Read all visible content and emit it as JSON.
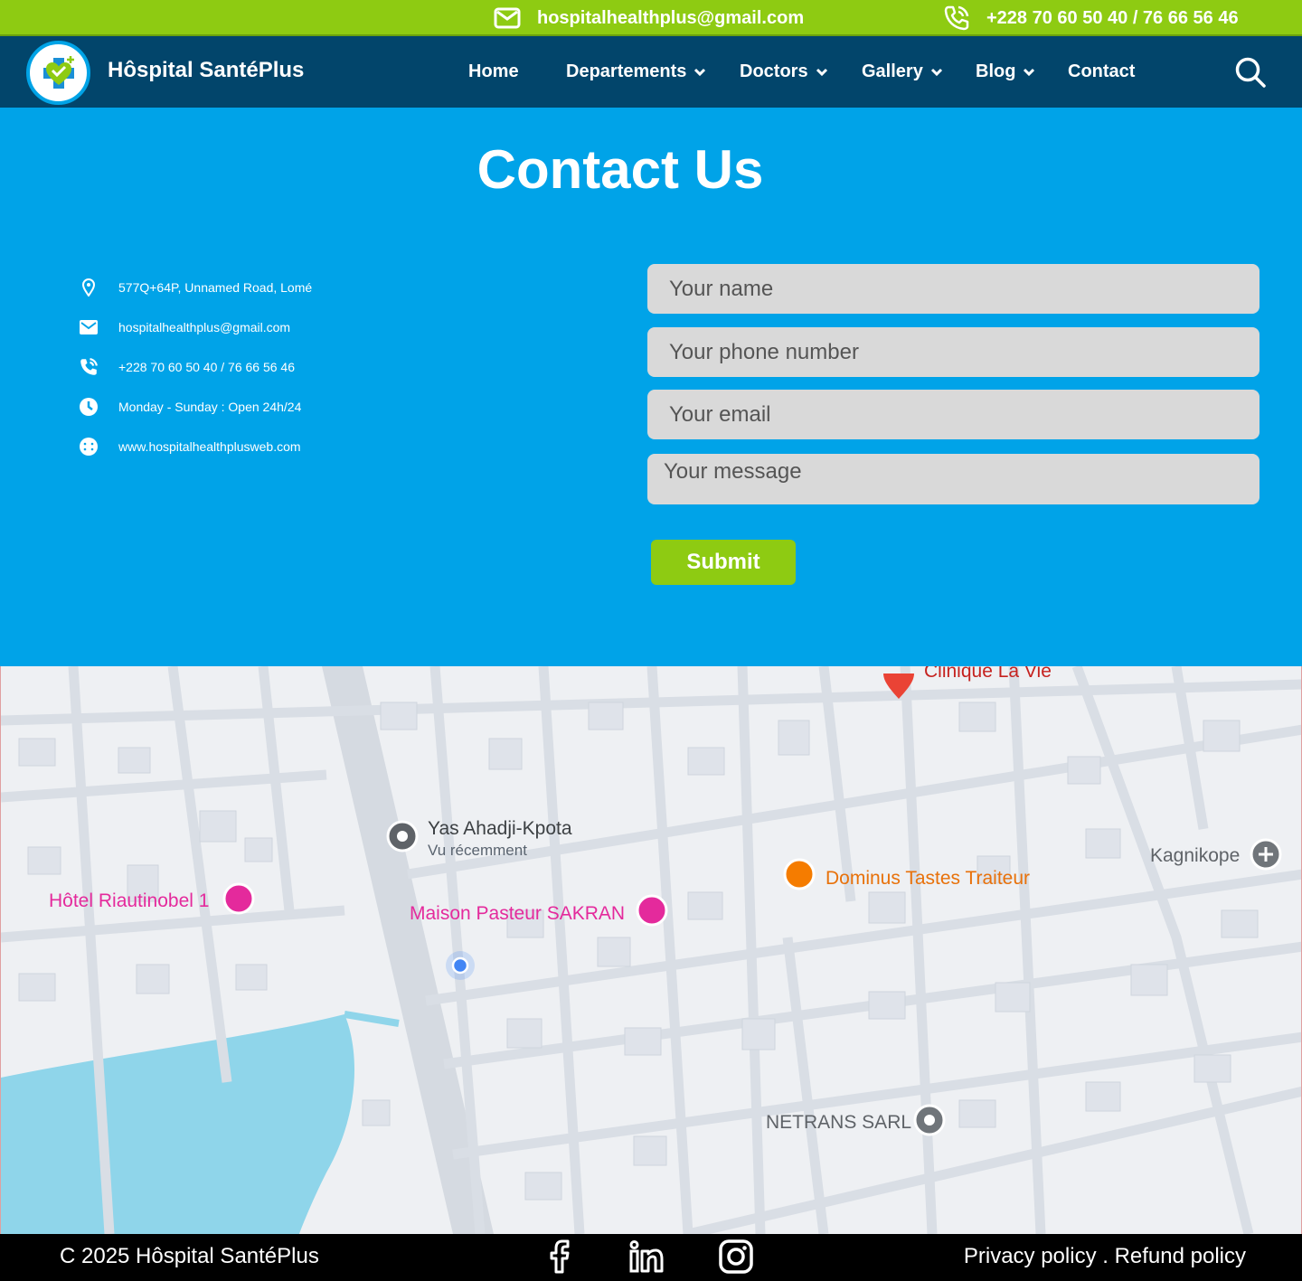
{
  "topbar": {
    "email": "hospitalhealthplus@gmail.com",
    "phone": "+228 70 60 50 40 / 76 66 56 46",
    "icons": {
      "email": "envelope-icon",
      "phone": "phone-icon"
    }
  },
  "nav": {
    "brand": "Hôspital SantéPlus",
    "items": [
      {
        "label": "Home"
      },
      {
        "label": "Departements"
      },
      {
        "label": "Doctors"
      },
      {
        "label": "Gallery"
      },
      {
        "label": "Blog"
      },
      {
        "label": "Contact"
      }
    ]
  },
  "contact": {
    "title": "Contact Us",
    "info": [
      {
        "icon": "location-pin-icon",
        "text": "577Q+64P, Unnamed Road, Lomé"
      },
      {
        "icon": "envelope-icon",
        "text": "hospitalhealthplus@gmail.com"
      },
      {
        "icon": "phone-icon",
        "text": "+228 70 60 50 40 / 76 66 56 46"
      },
      {
        "icon": "clock-icon",
        "text": "Monday - Sunday : Open 24h/24"
      },
      {
        "icon": "globe-icon",
        "text": "www.hospitalhealthplusweb.com"
      }
    ],
    "form": {
      "name_placeholder": "Your name",
      "phone_placeholder": "Your phone number",
      "email_placeholder": "Your email",
      "message_placeholder": "Your message",
      "submit_label": "Submit"
    }
  },
  "map": {
    "places": [
      {
        "name": "Clinique La Vie",
        "color": "#c5221f"
      },
      {
        "name": "Yas Ahadji-Kpota",
        "sub": "Vu récemment",
        "color": "#3c4043"
      },
      {
        "name": "Dominus Tastes Traiteur",
        "color": "#e8710a"
      },
      {
        "name": "Kagnikope",
        "color": "#5f6368"
      },
      {
        "name": "Hôtel Riautinobel 1",
        "color": "#e42a9c"
      },
      {
        "name": "Maison Pasteur SAKRAN",
        "color": "#e42a9c"
      },
      {
        "name": "NETRANS SARL",
        "color": "#5f6368"
      }
    ]
  },
  "footer": {
    "copyright": "C 2025 Hôspital SantéPlus",
    "legal": "Privacy policy . Refund policy",
    "social": [
      "facebook-icon",
      "linkedin-icon",
      "instagram-icon"
    ]
  },
  "colors": {
    "topbar": "#8ecb12",
    "nav": "#02456b",
    "contact_bg": "#00a3e8",
    "field_bg": "#d9d9d9",
    "submit": "#8ecb12",
    "footer": "#000000"
  }
}
